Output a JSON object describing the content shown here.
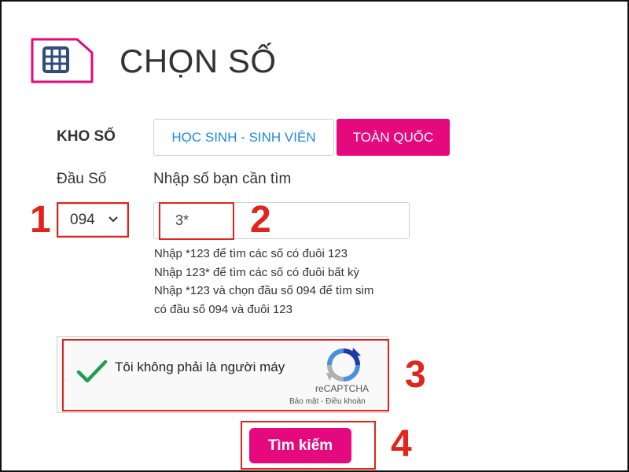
{
  "header": {
    "title": "CHỌN SỐ",
    "icon": "sim-card-icon",
    "accent": "#e4097d"
  },
  "kho_so": {
    "label": "KHO SỐ",
    "tabs": [
      {
        "label": "HỌC SINH - SINH VIÊN",
        "active": false
      },
      {
        "label": "TOÀN QUỐC",
        "active": true
      }
    ]
  },
  "dau_so": {
    "label": "Đầu Số",
    "selected": "094"
  },
  "search_number": {
    "label": "Nhập số bạn cần tìm",
    "value": "3*"
  },
  "hints": [
    "Nhập *123 để tìm các số có đuôi 123",
    "Nhập 123* để tìm các số có đuôi bất kỳ",
    "Nhập *123 và chọn đầu số 094 để tìm sim",
    "có đầu số 094 và đuôi 123"
  ],
  "captcha": {
    "label": "Tôi không phải là người máy",
    "brand": "reCAPTCHA",
    "privacy": "Bảo mật",
    "separator": "-",
    "terms": "Điều khoản",
    "checked": true
  },
  "search_button": {
    "label": "Tìm kiếm"
  },
  "annotations": {
    "step1": "1",
    "step2": "2",
    "step3": "3",
    "step4": "4",
    "color": "#e1251b"
  }
}
